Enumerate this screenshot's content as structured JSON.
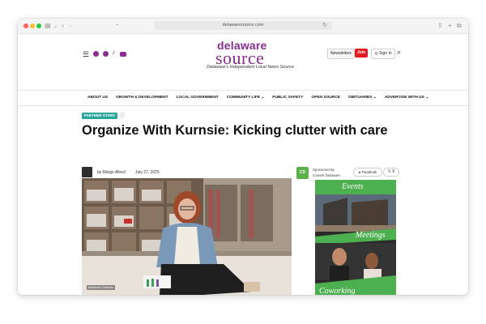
{
  "browser": {
    "url": "delawaresource.com"
  },
  "header": {
    "logo_top": "delaware",
    "logo_bottom": "source",
    "tagline": "Delaware's Independent Local News Source",
    "newsletters_label": "Newsletters",
    "join_label": "Join",
    "signin_label": "Sign In"
  },
  "nav": {
    "items": [
      {
        "label": "ABOUT US"
      },
      {
        "label": "GROWTH & DEVELOPMENT"
      },
      {
        "label": "LOCAL GOVERNMENT"
      },
      {
        "label": "COMMUNITY LIFE ⌄"
      },
      {
        "label": "PUBLIC SAFETY"
      },
      {
        "label": "OPEN SOURCE"
      },
      {
        "label": "OBITUARIES ⌄"
      },
      {
        "label": "ADVERTISE WITH US ⌄"
      }
    ]
  },
  "article": {
    "badge": "PARTNER STORY",
    "headline": "Organize With Kurnsie: Kicking clutter with care",
    "byline": "by Margo Allred",
    "date": "July 27, 2025",
    "sponsor_label": "Sponsored By",
    "sponsor_name": "Cowork Delaware",
    "sponsor_logo_text": "CD",
    "share_facebook": "Facebook",
    "share_x": "X",
    "image_caption": "Makenzie Roberts"
  },
  "ad": {
    "events": "Events",
    "meetings": "Meetings",
    "coworking": "Coworking"
  },
  "colors": {
    "brand": "#8a2b8f",
    "join": "#e11b22",
    "badge": "#2aa59b",
    "sponsor": "#5bb04a"
  }
}
